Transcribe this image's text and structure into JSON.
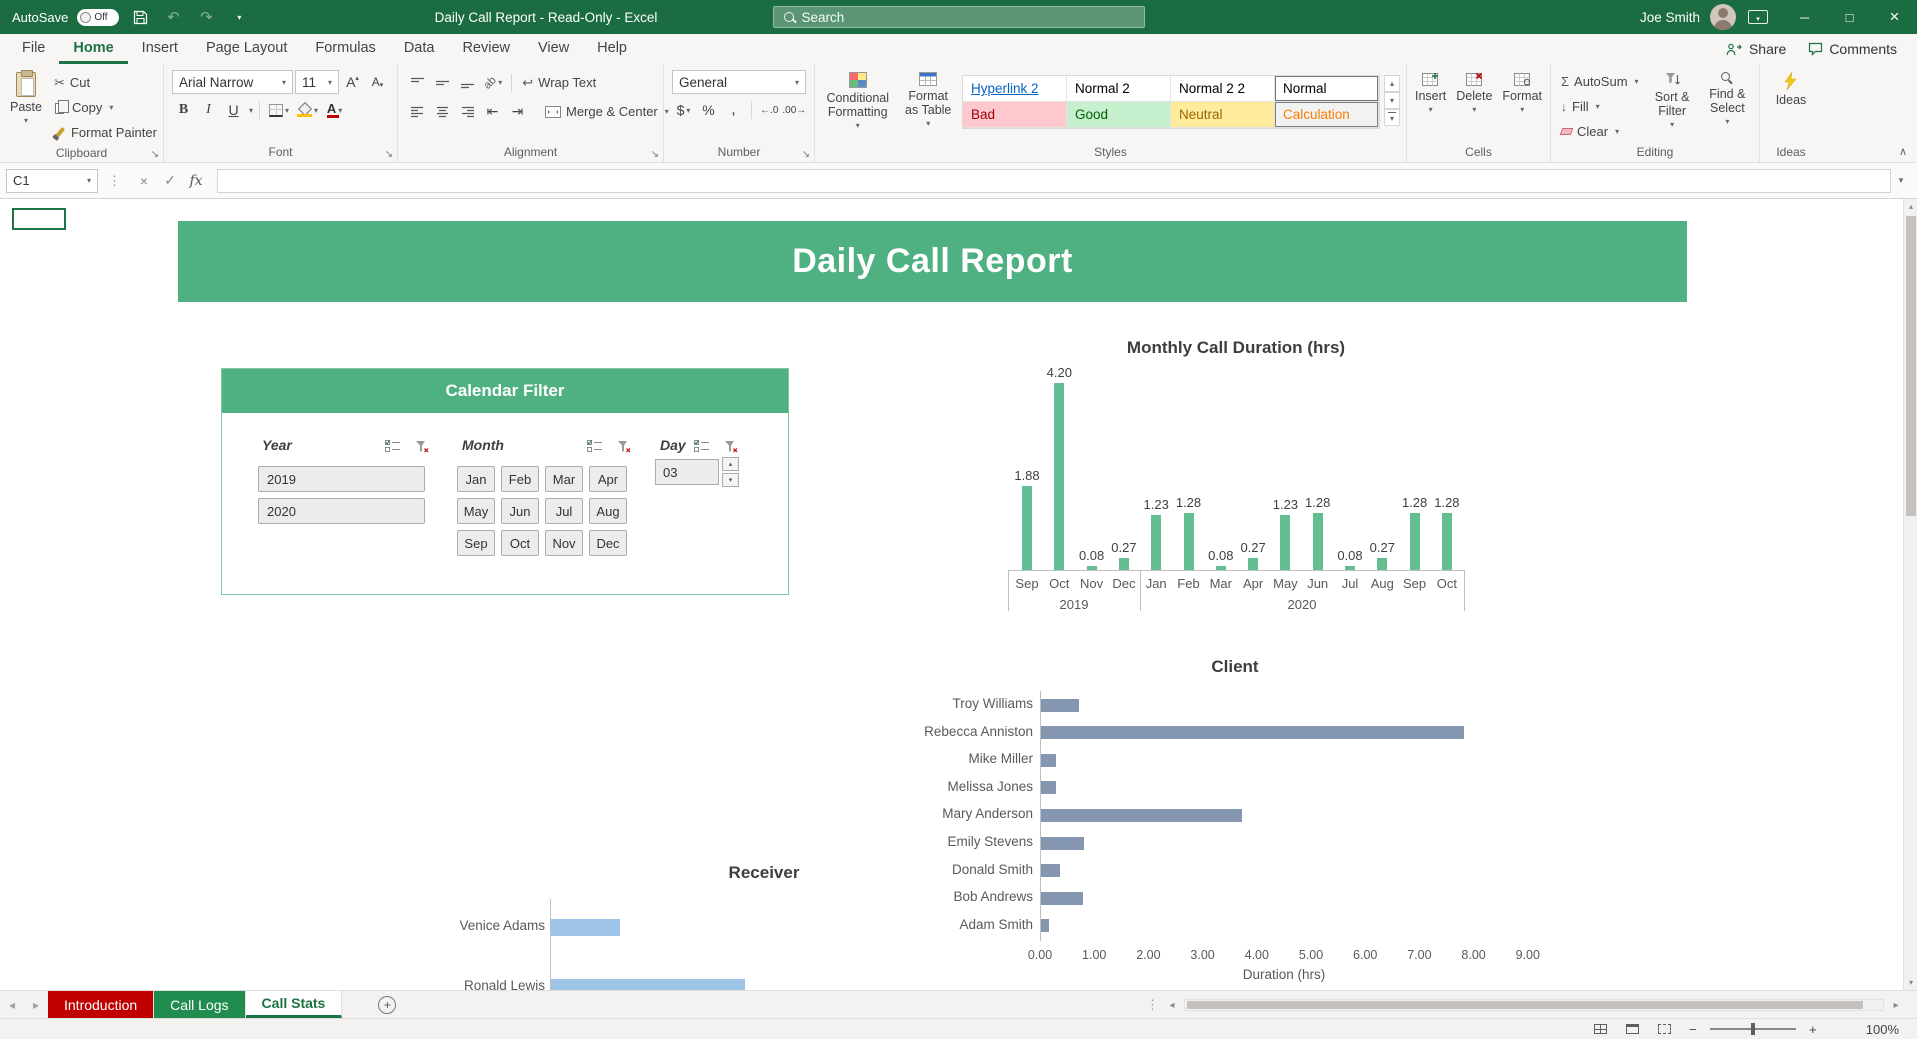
{
  "colors": {
    "title_bar_green": "#1B6C41",
    "ribbon_accent_green": "#1F7244",
    "banner_green": "#4FB082",
    "column_bar_green": "#63BE92",
    "client_bar_blue": "#8496B0",
    "receiver_bar_blue": "#9DC3E6"
  },
  "titlebar": {
    "autosave_label": "AutoSave",
    "autosave_state": "Off",
    "title": "Daily Call Report  -  Read-Only  -  Excel",
    "search_placeholder": "Search",
    "user_name": "Joe Smith"
  },
  "tabs": {
    "items": [
      "File",
      "Home",
      "Insert",
      "Page Layout",
      "Formulas",
      "Data",
      "Review",
      "View",
      "Help"
    ],
    "active": "Home",
    "share_label": "Share",
    "comments_label": "Comments"
  },
  "ribbon": {
    "clipboard": {
      "group": "Clipboard",
      "paste": "Paste",
      "cut": "Cut",
      "copy": "Copy",
      "format_painter": "Format Painter"
    },
    "font": {
      "group": "Font",
      "name": "Arial Narrow",
      "size": "11"
    },
    "alignment": {
      "group": "Alignment",
      "wrap": "Wrap Text",
      "merge": "Merge & Center"
    },
    "number": {
      "group": "Number",
      "format": "General"
    },
    "styles": {
      "group": "Styles",
      "conditional": "Conditional Formatting",
      "format_table": "Format as Table",
      "gallery": [
        {
          "label": "Hyperlink 2",
          "fg": "#0563C1",
          "bg": "#FFFFFF",
          "underline": true
        },
        {
          "label": "Normal 2",
          "fg": "#000000",
          "bg": "#FFFFFF"
        },
        {
          "label": "Normal 2 2",
          "fg": "#000000",
          "bg": "#FFFFFF"
        },
        {
          "label": "Normal",
          "fg": "#000000",
          "bg": "#FFFFFF",
          "selected": true
        },
        {
          "label": "Bad",
          "fg": "#9C0006",
          "bg": "#FFC7CE"
        },
        {
          "label": "Good",
          "fg": "#006100",
          "bg": "#C6EFCE"
        },
        {
          "label": "Neutral",
          "fg": "#9C6500",
          "bg": "#FFEB9C"
        },
        {
          "label": "Calculation",
          "fg": "#FA7D00",
          "bg": "#F2F2F2",
          "bordered": true
        }
      ]
    },
    "cells": {
      "group": "Cells",
      "insert": "Insert",
      "delete": "Delete",
      "format": "Format"
    },
    "editing": {
      "group": "Editing",
      "autosum": "AutoSum",
      "fill": "Fill",
      "clear": "Clear",
      "sort_filter": "Sort & Filter",
      "find_select": "Find & Select"
    },
    "ideas": {
      "group": "Ideas",
      "button": "Ideas"
    }
  },
  "formula_bar": {
    "name_box": "C1",
    "formula": ""
  },
  "worksheet": {
    "banner_title": "Daily Call Report",
    "calendar_filter": {
      "title": "Calendar Filter",
      "year": {
        "label": "Year",
        "items": [
          "2019",
          "2020"
        ]
      },
      "month": {
        "label": "Month",
        "items": [
          "Jan",
          "Feb",
          "Mar",
          "Apr",
          "May",
          "Jun",
          "Jul",
          "Aug",
          "Sep",
          "Oct",
          "Nov",
          "Dec"
        ]
      },
      "day": {
        "label": "Day",
        "value": "03"
      }
    }
  },
  "chart_data": [
    {
      "type": "bar",
      "title": "Monthly Call Duration (hrs)",
      "categories": [
        "Sep",
        "Oct",
        "Nov",
        "Dec",
        "Jan",
        "Feb",
        "Mar",
        "Apr",
        "May",
        "Jun",
        "Jul",
        "Aug",
        "Sep",
        "Oct"
      ],
      "group_axis": [
        {
          "label": "2019",
          "count": 4
        },
        {
          "label": "2020",
          "count": 10
        }
      ],
      "values": [
        1.88,
        4.2,
        0.08,
        0.27,
        1.23,
        1.28,
        0.08,
        0.27,
        1.23,
        1.28,
        0.08,
        0.27,
        1.28,
        1.28
      ],
      "ylim": [
        0,
        4.5
      ],
      "bar_color": "#63BE92",
      "legend": "none",
      "data_labels": true
    },
    {
      "type": "bar-horizontal",
      "title": "Client",
      "categories": [
        "Troy Williams",
        "Rebecca Anniston",
        "Mike Miller",
        "Melissa Jones",
        "Mary Anderson",
        "Emily Stevens",
        "Donald Smith",
        "Bob Andrews",
        "Adam Smith"
      ],
      "values": [
        0.7,
        7.8,
        0.28,
        0.28,
        3.7,
        0.8,
        0.35,
        0.77,
        0.15
      ],
      "xlabel": "Duration (hrs)",
      "xlim": [
        0,
        9
      ],
      "xticks": [
        "0.00",
        "1.00",
        "2.00",
        "3.00",
        "4.00",
        "5.00",
        "6.00",
        "7.00",
        "8.00",
        "9.00"
      ],
      "bar_color": "#8496B0"
    },
    {
      "type": "bar-horizontal",
      "title": "Receiver",
      "categories": [
        "Venice Adams",
        "Ronald Lewis"
      ],
      "values": [
        1.27,
        3.58
      ],
      "bar_color": "#9DC3E6"
    }
  ],
  "sheet_tabs": {
    "items": [
      {
        "label": "Introduction",
        "color": "#C00000",
        "text": "#FFFFFF"
      },
      {
        "label": "Call Logs",
        "color": "#218C50",
        "text": "#FFFFFF"
      },
      {
        "label": "Call Stats",
        "active": true,
        "accent": "#1F7244"
      }
    ]
  },
  "status_bar": {
    "zoom": "100%"
  }
}
